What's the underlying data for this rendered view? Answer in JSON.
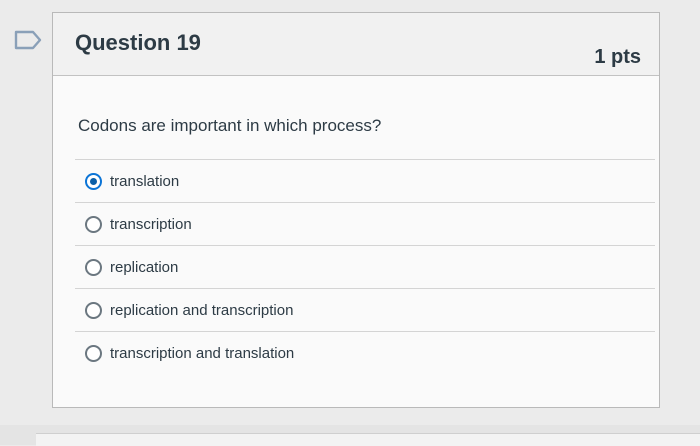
{
  "question": {
    "title": "Question 19",
    "points": "1 pts",
    "text": "Codons are important in which process?",
    "flag_icon": "bookmark-flag-icon"
  },
  "answers": [
    {
      "label": "translation",
      "selected": true
    },
    {
      "label": "transcription",
      "selected": false
    },
    {
      "label": "replication",
      "selected": false
    },
    {
      "label": "replication and transcription",
      "selected": false
    },
    {
      "label": "transcription and translation",
      "selected": false
    }
  ],
  "colors": {
    "accent": "#0b74d6",
    "text": "#2d3b45",
    "header_bg": "#f1f1f1"
  }
}
